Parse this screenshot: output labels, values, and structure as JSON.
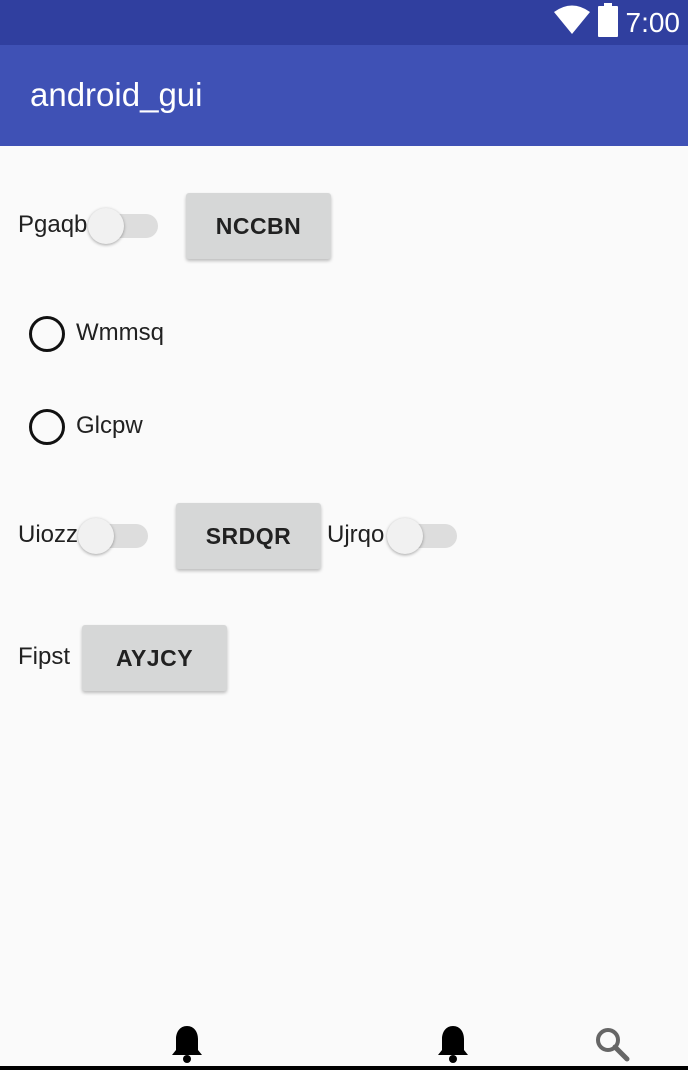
{
  "status_bar": {
    "time": "7:00",
    "icons": [
      "wifi-icon",
      "battery-icon"
    ],
    "color": "#303f9f"
  },
  "app_bar": {
    "title": "android_gui",
    "color": "#3f51b5"
  },
  "rows": {
    "row1": {
      "switch_label": "Pgaqb",
      "switch_on": false,
      "button_label": "NCCBN"
    },
    "radio1": {
      "label": "Wmmsq",
      "checked": false
    },
    "radio2": {
      "label": "Glcpw",
      "checked": false
    },
    "row4": {
      "switch1_label": "Uiozz",
      "switch1_on": false,
      "button_label": "SRDQR",
      "switch2_label": "Ujrqo",
      "switch2_on": false
    },
    "row5": {
      "label": "Fipst",
      "button_label": "AYJCY"
    }
  },
  "bottom_bar": {
    "icons": [
      "bell-icon",
      "bell-icon",
      "search-icon"
    ]
  }
}
